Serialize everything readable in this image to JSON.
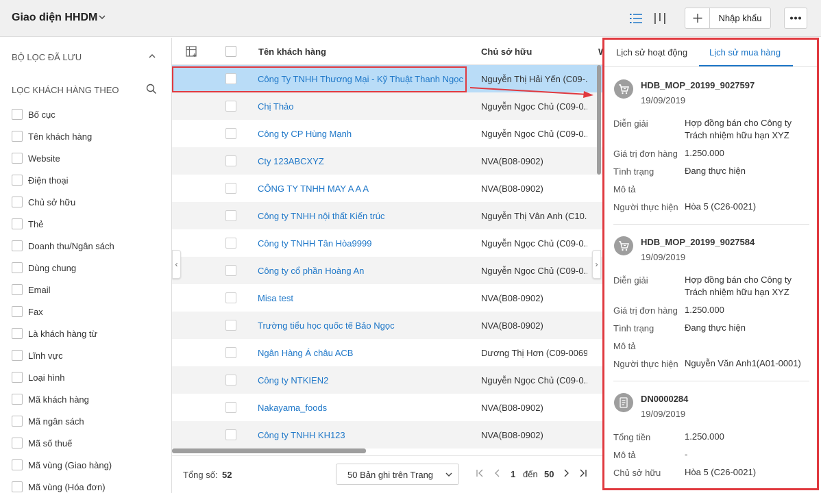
{
  "header": {
    "title": "Giao diện HHDM",
    "import_label": "Nhập khẩu"
  },
  "sidebar": {
    "saved_filters_label": "BỘ LỌC ĐÃ LƯU",
    "filter_by_label": "LỌC KHÁCH HÀNG THEO",
    "items": [
      "Bố cục",
      "Tên khách hàng",
      "Website",
      "Điện thoại",
      "Chủ sở hữu",
      "Thẻ",
      "Doanh thu/Ngân sách",
      "Dùng chung",
      "Email",
      "Fax",
      "Là khách hàng từ",
      "Lĩnh vực",
      "Loại hình",
      "Mã khách hàng",
      "Mã ngân sách",
      "Mã số thuế",
      "Mã vùng (Giao hàng)",
      "Mã vùng (Hóa đơn)"
    ]
  },
  "grid": {
    "columns": {
      "name": "Tên khách hàng",
      "owner": "Chủ sở hữu",
      "extra": "W"
    },
    "rows": [
      {
        "name": "Công Ty TNHH Thương Mại - Kỹ Thuật Thanh Ngọc",
        "owner": "Nguyễn Thị Hải Yến (C09-..."
      },
      {
        "name": "Chị Thảo",
        "owner": "Nguyễn Ngọc Chủ (C09-0..."
      },
      {
        "name": "Công ty CP Hùng Mạnh",
        "owner": "Nguyễn Ngọc Chủ (C09-0..."
      },
      {
        "name": "Cty 123ABCXYZ",
        "owner": "NVA(B08-0902)"
      },
      {
        "name": "CÔNG TY TNHH MAY A A A",
        "owner": "NVA(B08-0902)"
      },
      {
        "name": "Công ty TNHH nội thất Kiến trúc",
        "owner": "Nguyễn Thị Vân Anh (C10..."
      },
      {
        "name": "Công ty TNHH Tân Hòa9999",
        "owner": "Nguyễn Ngọc Chủ (C09-0..."
      },
      {
        "name": "Công ty cổ phần Hoàng An",
        "owner": "Nguyễn Ngọc Chủ (C09-0..."
      },
      {
        "name": "Misa test",
        "owner": "NVA(B08-0902)"
      },
      {
        "name": "Trường tiểu học quốc tế Bảo Ngọc",
        "owner": "NVA(B08-0902)"
      },
      {
        "name": "Ngân Hàng Á châu ACB",
        "owner": "Dương Thị Hơn (C09-0069)"
      },
      {
        "name": "Công ty NTKIEN2",
        "owner": "Nguyễn Ngọc Chủ (C09-0..."
      },
      {
        "name": "Nakayama_foods",
        "owner": "NVA(B08-0902)"
      },
      {
        "name": "Công ty TNHH KH123",
        "owner": "NVA(B08-0902)"
      }
    ]
  },
  "footer": {
    "total_label": "Tổng số:",
    "total_value": "52",
    "page_size": "50 Bản ghi trên Trang",
    "current_page": "1",
    "to_label": "đến",
    "page_to": "50"
  },
  "panel": {
    "tabs": [
      "Lịch sử hoạt động",
      "Lịch sử mua hàng"
    ],
    "cards": [
      {
        "code": "HDB_MOP_20199_9027597",
        "date": "19/09/2019",
        "icon": "cart-icon",
        "fields": [
          {
            "k": "Diễn giải",
            "v": "Hợp đồng bán cho Công ty Trách nhiệm hữu hạn XYZ"
          },
          {
            "k": "Giá trị đơn hàng",
            "v": "1.250.000"
          },
          {
            "k": "Tình trạng",
            "v": "Đang thực hiện"
          },
          {
            "k": "Mô tả",
            "v": ""
          },
          {
            "k": "Người thực hiện",
            "v": "Hòa 5 (C26-0021)"
          }
        ]
      },
      {
        "code": "HDB_MOP_20199_9027584",
        "date": "19/09/2019",
        "icon": "cart-icon",
        "fields": [
          {
            "k": "Diễn giải",
            "v": "Hợp đồng bán cho Công ty Trách nhiệm hữu hạn XYZ"
          },
          {
            "k": "Giá trị đơn hàng",
            "v": "1.250.000"
          },
          {
            "k": "Tình trạng",
            "v": "Đang thực hiện"
          },
          {
            "k": "Mô tả",
            "v": ""
          },
          {
            "k": "Người thực hiện",
            "v": "Nguyễn Văn Anh1(A01-0001)"
          }
        ]
      },
      {
        "code": "DN0000284",
        "date": "19/09/2019",
        "icon": "invoice-icon",
        "fields": [
          {
            "k": "Tổng tiền",
            "v": "1.250.000"
          },
          {
            "k": "Mô tả",
            "v": "-"
          },
          {
            "k": "Chủ sở hữu",
            "v": "Hòa 5 (C26-0021)"
          }
        ]
      }
    ]
  },
  "colors": {
    "link": "#1e77c8",
    "highlight_red": "#e0393f",
    "selected_row": "#b9dcf7",
    "header_bg": "#f0f0f0"
  }
}
